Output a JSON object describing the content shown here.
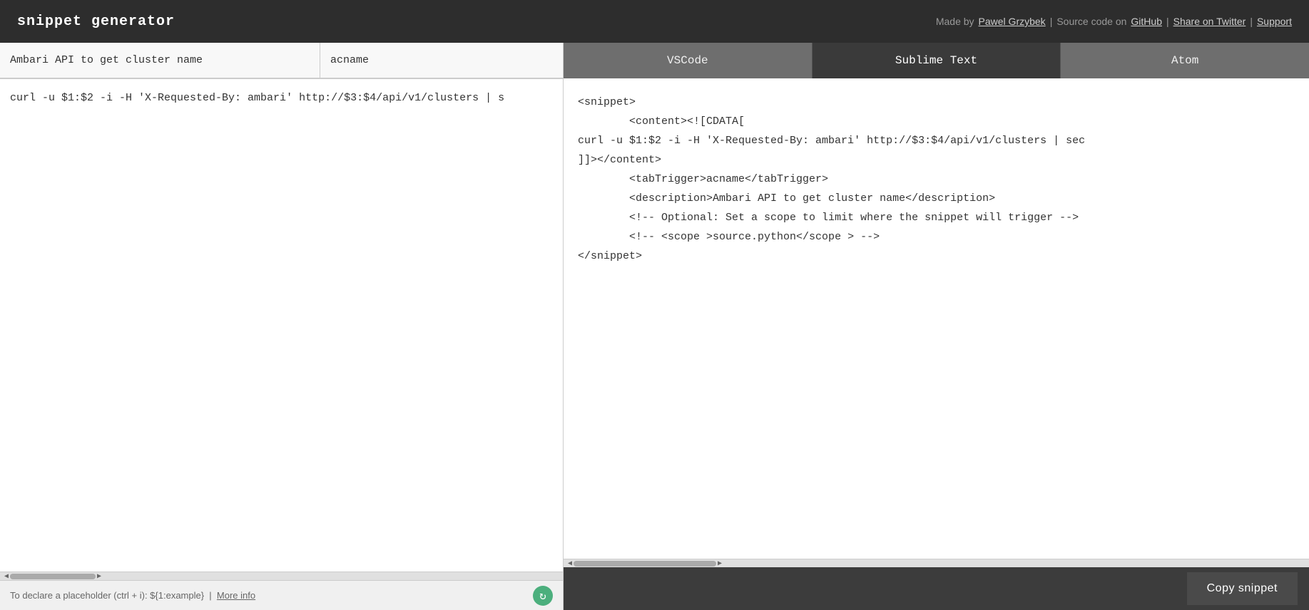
{
  "header": {
    "title": "snippet generator",
    "made_by_text": "Made by",
    "author_name": "Pawel Grzybek",
    "source_label": "Source code on",
    "github_label": "GitHub",
    "share_label": "Share on Twitter",
    "support_label": "Support",
    "separator": "|"
  },
  "left": {
    "description_placeholder": "Ambari API to get cluster name",
    "description_value": "Ambari API to get cluster name",
    "tab_trigger_placeholder": "acname",
    "tab_trigger_value": "acname",
    "code_value": "curl -u $1:$2 -i -H 'X-Requested-By: ambari' http://$3:$4/api/v1/clusters | s",
    "hint_text": "To declare a placeholder (ctrl + i): ${1:example}",
    "hint_link_text": "More info",
    "refresh_icon": "↻"
  },
  "right": {
    "tabs": [
      {
        "label": "VSCode",
        "active": false
      },
      {
        "label": "Sublime Text",
        "active": true
      },
      {
        "label": "Atom",
        "active": false
      }
    ],
    "snippet_content": "<snippet>\n\t<content><![CDATA[\ncurl -u $1:$2 -i -H 'X-Requested-By: ambari' http://$3:$4/api/v1/clusters | sec\n]]></content>\n\t<tabTrigger>acname</tabTrigger>\n\t<description>Ambari API to get cluster name</description>\n\t<!-- Optional: Set a scope to limit where the snippet will trigger -->\n\t<!-- <scope >source.python</scope > -->\n</snippet>",
    "copy_button_label": "Copy snippet"
  }
}
